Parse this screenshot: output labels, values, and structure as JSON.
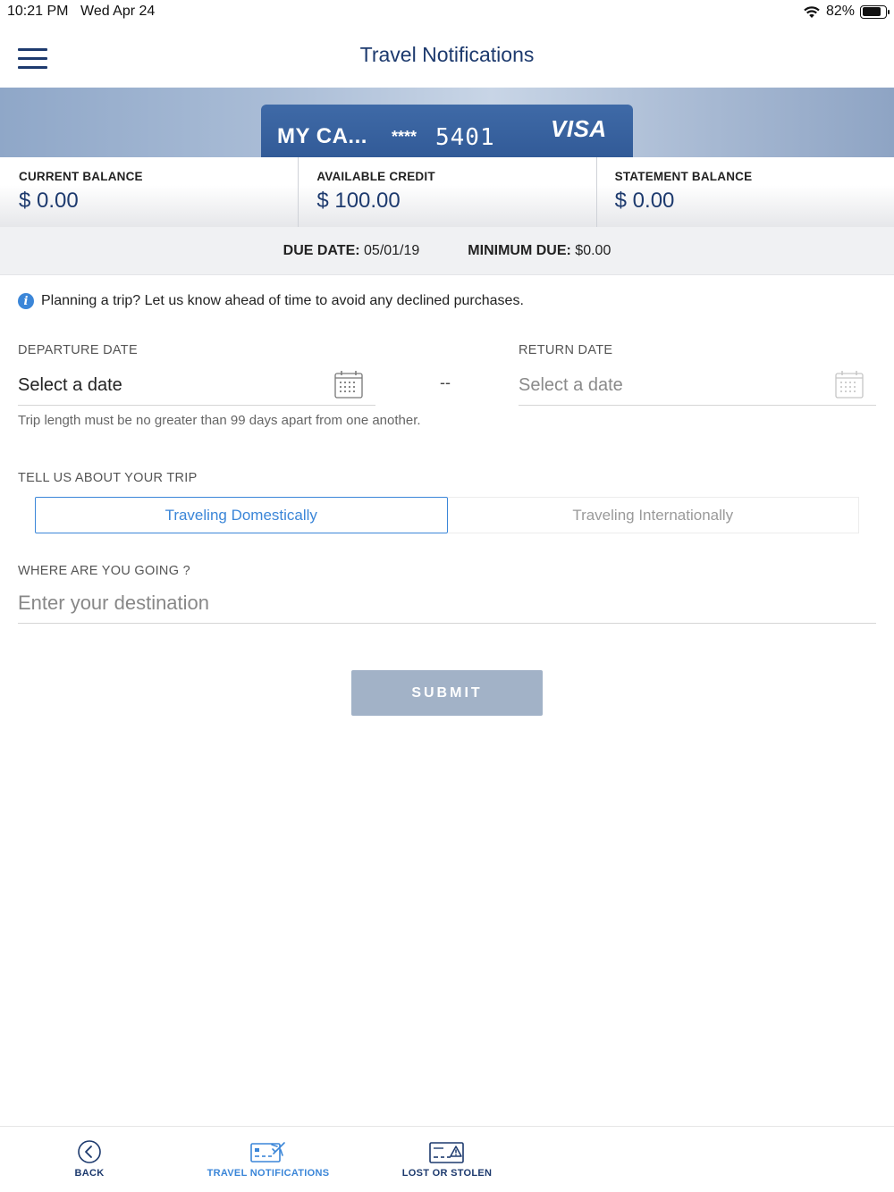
{
  "status_bar": {
    "time": "10:21 PM",
    "date": "Wed Apr 24",
    "battery": "82%",
    "battery_level": 0.82
  },
  "header": {
    "title": "Travel Notifications",
    "menu_icon": "hamburger-icon"
  },
  "card": {
    "name": "MY CA...",
    "mask": "****",
    "last4": "5401",
    "brand": "VISA"
  },
  "balances": [
    {
      "label": "CURRENT BALANCE",
      "value": "$ 0.00"
    },
    {
      "label": "AVAILABLE CREDIT",
      "value": "$ 100.00"
    },
    {
      "label": "STATEMENT BALANCE",
      "value": "$ 0.00"
    }
  ],
  "due": {
    "due_date_label": "DUE DATE:",
    "due_date_value": "05/01/19",
    "minimum_due_label": "MINIMUM DUE:",
    "minimum_due_value": "$0.00"
  },
  "info": {
    "text": "Planning a trip? Let us know ahead of time to avoid any declined purchases.",
    "icon": "info-icon"
  },
  "departure": {
    "label": "DEPARTURE DATE",
    "value": "Select a date",
    "icon": "calendar-icon"
  },
  "separator": "--",
  "return_date": {
    "label": "RETURN DATE",
    "value": "Select a date",
    "icon": "calendar-icon"
  },
  "hint": "Trip length must be no greater than 99 days apart from one another.",
  "trip": {
    "label": "TELL US ABOUT YOUR TRIP",
    "options": [
      {
        "label": "Traveling Domestically",
        "selected": true
      },
      {
        "label": "Traveling Internationally",
        "selected": false
      }
    ]
  },
  "destination": {
    "label": "WHERE ARE YOU GOING ?",
    "placeholder": "Enter your destination",
    "value": ""
  },
  "submit_label": "SUBMIT",
  "tabs": [
    {
      "label": "BACK",
      "icon": "back-arrow-icon"
    },
    {
      "label": "TRAVEL NOTIFICATIONS",
      "icon": "travel-card-plane-icon",
      "active": true
    },
    {
      "label": "LOST OR STOLEN",
      "icon": "card-warning-icon"
    }
  ],
  "colors": {
    "primary": "#1d3a6e",
    "accent": "#3b86d8",
    "submit_disabled": "#a2b2c7"
  }
}
